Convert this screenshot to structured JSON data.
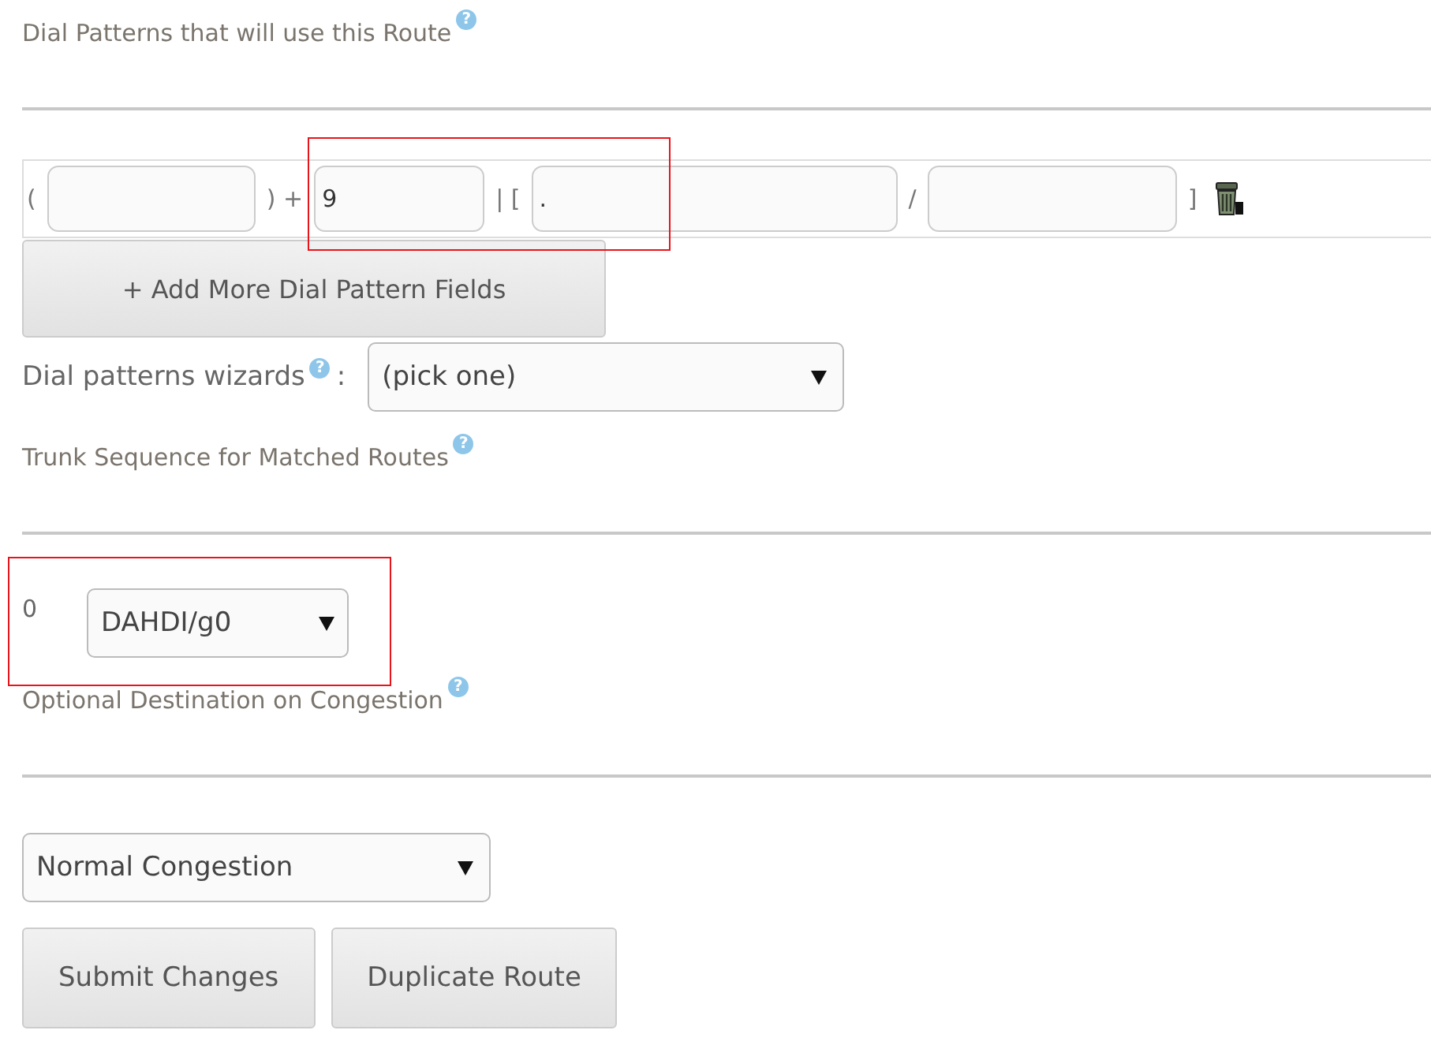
{
  "dial_patterns_heading": {
    "label": "Dial Patterns that will use this Route",
    "help": "?"
  },
  "dial_pattern": {
    "open": "(",
    "after_prepend": ") +",
    "prefix": "9",
    "after_prefix": "| [",
    "match_pattern": ".",
    "slash": "/",
    "close": "]",
    "highlighted": true
  },
  "add_button": "+ Add More Dial Pattern Fields",
  "wizard": {
    "label": "Dial patterns wizards",
    "help": "?",
    "colon": ":",
    "value": "(pick one)"
  },
  "trunk_heading": {
    "label": "Trunk Sequence for Matched Routes",
    "help": "?"
  },
  "trunks": [
    {
      "index": "0",
      "value": "DAHDI/g0",
      "highlighted": true
    }
  ],
  "congestion_heading": {
    "label": "Optional Destination on Congestion",
    "help": "?"
  },
  "congestion": {
    "value": "Normal Congestion"
  },
  "buttons": [
    "Submit Changes",
    "Duplicate Route"
  ]
}
